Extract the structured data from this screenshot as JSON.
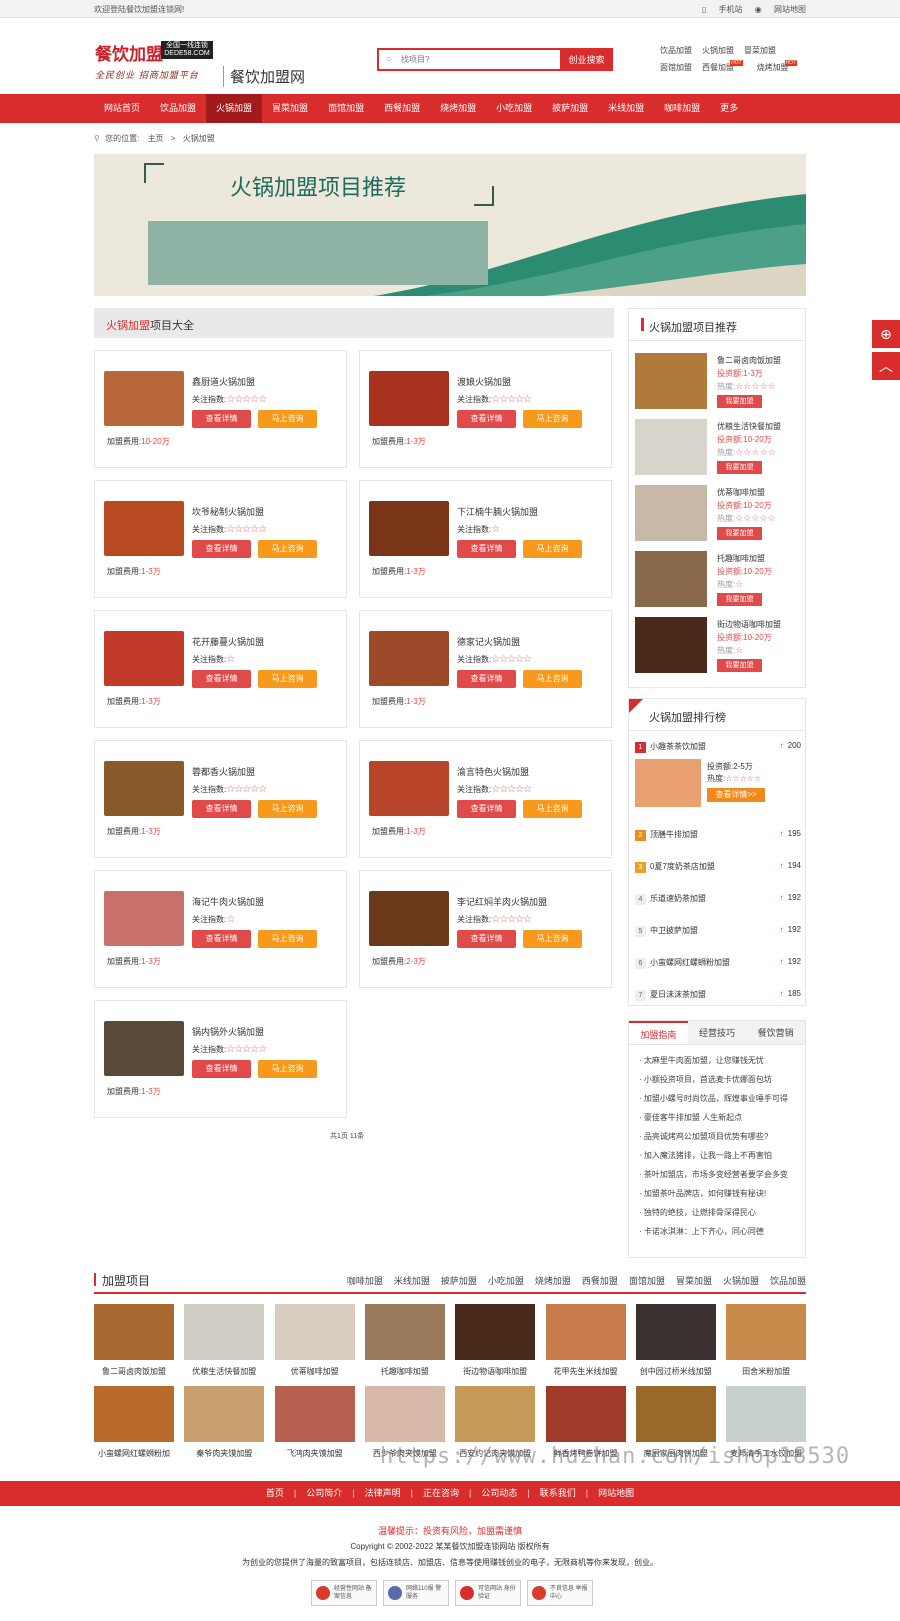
{
  "topbar": {
    "welcome": "欢迎登陆餐饮加盟连锁网!",
    "mobile": "手机站",
    "sitemap": "网站地图"
  },
  "header": {
    "logo_main": "餐饮加盟",
    "logo_badge": "全国一线连锁 DEDE58.COM",
    "logo_slogan": "全民创业 招商加盟平台",
    "site_name": "餐饮加盟网",
    "search_placeholder": "找项目?",
    "search_button": "创业搜索",
    "hotlinks": [
      {
        "label": "饮品加盟",
        "hot": ""
      },
      {
        "label": "火锅加盟",
        "hot": ""
      },
      {
        "label": "冒菜加盟",
        "hot": ""
      },
      {
        "label": "面馆加盟",
        "hot": ""
      },
      {
        "label": "西餐加盟",
        "hot": "HOT"
      },
      {
        "label": "烧烤加盟",
        "hot": "HOT"
      }
    ]
  },
  "nav": [
    "网站首页",
    "饮品加盟",
    "火锅加盟",
    "冒菜加盟",
    "面馆加盟",
    "西餐加盟",
    "烧烤加盟",
    "小吃加盟",
    "披萨加盟",
    "米线加盟",
    "咖啡加盟",
    "更多"
  ],
  "breadcrumb": {
    "prefix": "您的位置:",
    "home": "主页",
    "sep": ">",
    "current": "火锅加盟"
  },
  "banner": {
    "title": "火锅加盟项目推荐"
  },
  "list": {
    "head_red": "火锅加盟",
    "head_rest": "项目大全",
    "attention_label": "关注指数:",
    "fee_label": "加盟费用:",
    "detail_btn": "查看详情",
    "consult_btn": "马上咨询",
    "items": [
      {
        "name": "鑫厨道火锅加盟",
        "stars": 5,
        "fee": "10-20万",
        "color": "#b8663a"
      },
      {
        "name": "渡娘火锅加盟",
        "stars": 5,
        "fee": "1-3万",
        "color": "#a8321e"
      },
      {
        "name": "坎爷秘制火锅加盟",
        "stars": 5,
        "fee": "1-3万",
        "color": "#b84a22"
      },
      {
        "name": "下江楠牛腩火锅加盟",
        "stars": 1,
        "fee": "1-3万",
        "color": "#7a3418"
      },
      {
        "name": "花开藤蔓火锅加盟",
        "stars": 1,
        "fee": "1-3万",
        "color": "#c23a2a"
      },
      {
        "name": "德家记火锅加盟",
        "stars": 5,
        "fee": "1-3万",
        "color": "#9c4a2a"
      },
      {
        "name": "蓉都香火锅加盟",
        "stars": 5,
        "fee": "1-3万",
        "color": "#8a5a2a"
      },
      {
        "name": "渝言特色火锅加盟",
        "stars": 5,
        "fee": "1-3万",
        "color": "#b8452a"
      },
      {
        "name": "海记牛肉火锅加盟",
        "stars": 1,
        "fee": "1-3万",
        "color": "#c8706a"
      },
      {
        "name": "李记红焖羊肉火锅加盟",
        "stars": 5,
        "fee": "2-3万",
        "color": "#6a3a1a"
      },
      {
        "name": "锅内锅外火锅加盟",
        "stars": 5,
        "fee": "1-3万",
        "color": "#5a4a3a"
      }
    ]
  },
  "pager": "共1页 11条",
  "side_rec": {
    "title": "火锅加盟项目推荐",
    "invest_label": "投资额:",
    "heat_label": "热度:",
    "btn": "我要加盟",
    "items": [
      {
        "name": "鲁二哥卤肉饭加盟",
        "invest": "1-3万",
        "stars": 5,
        "color": "#b07a3a"
      },
      {
        "name": "优粮生活快餐加盟",
        "invest": "10-20万",
        "stars": 5,
        "color": "#d8d4cc"
      },
      {
        "name": "优蒂咖啡加盟",
        "invest": "10-20万",
        "stars": 5,
        "color": "#c8b8a8"
      },
      {
        "name": "托趣咖啡加盟",
        "invest": "10-20万",
        "stars": 1,
        "color": "#8a6a4a"
      },
      {
        "name": "街边物语咖啡加盟",
        "invest": "10-20万",
        "stars": 1,
        "color": "#4a2a1a"
      }
    ]
  },
  "side_rank": {
    "title": "火锅加盟排行榜",
    "invest_label": "投资额:",
    "invest": "2-5万",
    "heat_label": "热度:",
    "detail_btn": "查看详情>>",
    "items": [
      {
        "no": "1",
        "name": "小趣茶茶饮加盟",
        "count": "200"
      },
      {
        "no": "2",
        "name": "顶膳牛排加盟",
        "count": "195"
      },
      {
        "no": "3",
        "name": "0夏7度奶茶店加盟",
        "count": "194"
      },
      {
        "no": "4",
        "name": "乐道速奶茶加盟",
        "count": "192"
      },
      {
        "no": "5",
        "name": "中卫披萨加盟",
        "count": "192"
      },
      {
        "no": "6",
        "name": "小蛮螺网红螺蛳粉加盟",
        "count": "192"
      },
      {
        "no": "7",
        "name": "夏日沫沫茶加盟",
        "count": "185"
      }
    ]
  },
  "side_tabs": {
    "tabs": [
      "加盟指南",
      "经营技巧",
      "餐饮营销"
    ],
    "items": [
      "· 太麻里牛肉面加盟，让您赚钱无忧",
      "· 小额投资项目，首选麦卡优娜面包坊",
      "· 加盟小螺号时尚饮品，辉煌事业唾手可得",
      "· 豪佳客牛排加盟 人生新起点",
      "· 品亮诚烤鸡公加盟项目优势有哪些?",
      "· 加入魔法猪排，让我一路上不再害怕",
      "· 茶叶加盟店，市场多变经营者要学会多变",
      "· 加盟茶叶品牌店，如何赚钱有秘诀!",
      "· 独特的绝技，让燃排骨深得民心",
      "· 卡诺冰淇淋：上下齐心，同心同德"
    ]
  },
  "projects": {
    "title": "加盟项目",
    "cats": [
      "咖啡加盟",
      "米线加盟",
      "披萨加盟",
      "小吃加盟",
      "烧烤加盟",
      "西餐加盟",
      "面馆加盟",
      "冒菜加盟",
      "火锅加盟",
      "饮品加盟"
    ],
    "items": [
      {
        "name": "鲁二哥卤肉饭加盟",
        "color": "#a86a30"
      },
      {
        "name": "优粮生活快餐加盟",
        "color": "#d0ccc4"
      },
      {
        "name": "优蒂咖啡加盟",
        "color": "#d8ccc0"
      },
      {
        "name": "托趣咖啡加盟",
        "color": "#9a7a5a"
      },
      {
        "name": "街边物语咖啡加盟",
        "color": "#4a2a1a"
      },
      {
        "name": "花甲先生米线加盟",
        "color": "#c87a4a"
      },
      {
        "name": "创中园过桥米线加盟",
        "color": "#3a3030"
      },
      {
        "name": "田舍米粉加盟",
        "color": "#c88a4a"
      },
      {
        "name": "小蛮螺网红螺蛳粉加",
        "color": "#b86a2a"
      },
      {
        "name": "秦爷肉夹馍加盟",
        "color": "#c8a070"
      },
      {
        "name": "飞鸿肉夹馍加盟",
        "color": "#b86050"
      },
      {
        "name": "西少爷肉夹馍加盟",
        "color": "#d8b8a8"
      },
      {
        "name": "西安约记肉夹馍加盟",
        "color": "#c89a5a"
      },
      {
        "name": "鲜香烤鸭卷饼加盟",
        "color": "#a03a2a"
      },
      {
        "name": "魔厨家厨肉饼加盟",
        "color": "#9a6a2a"
      },
      {
        "name": "麦邦清手工水饺加盟",
        "color": "#c8d0cc"
      }
    ]
  },
  "watermark": "https://www.huzhan.com/ishop18530",
  "footer": {
    "links": [
      "首页",
      "公司简介",
      "法律声明",
      "正在咨询",
      "公司动态",
      "联系我们",
      "网站地图"
    ],
    "tip": "温馨提示：投资有风险，加盟需谨慎",
    "copyright": "Copyright © 2002-2022 某某餐饮加盟连锁网站 版权所有",
    "desc": "为创业的您提供了海量的致富项目，包括连锁店、加盟店、信息等使用赚钱创业的电子，无限商机等你来发现，创业。",
    "badges": [
      {
        "text": "经营性网站 备案信息",
        "color": "#d93a2a"
      },
      {
        "text": "网络110报 警服务",
        "color": "#5a6aa8"
      },
      {
        "text": "可信网站 身份验证",
        "color": "#d92c2c"
      },
      {
        "text": "不良信息 举报中心",
        "color": "#d93a2a"
      }
    ]
  },
  "floats": [
    "⊕",
    "︿"
  ]
}
